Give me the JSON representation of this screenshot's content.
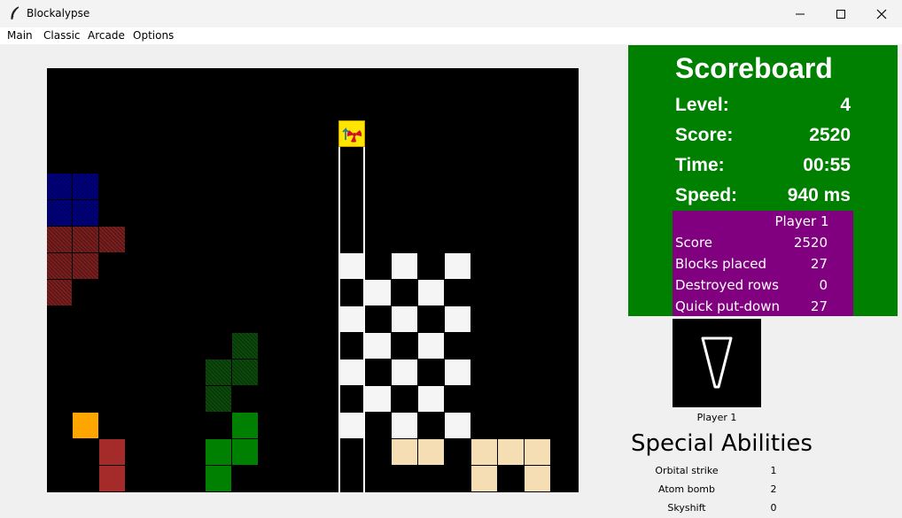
{
  "window": {
    "title": "Blockalypse",
    "controls": [
      "minimize-icon",
      "maximize-icon",
      "close-icon"
    ]
  },
  "menu": [
    "Main",
    "Classic",
    "Arcade",
    "Options"
  ],
  "board": {
    "columns": 20,
    "rows": 16,
    "background": "#000000",
    "falling_piece": {
      "type": "atom bomb",
      "icon": "radiation-icon",
      "column": 11,
      "row": 2
    },
    "blocks": [
      {
        "c": 0,
        "r": 4,
        "color": "#000080",
        "style": "hatch"
      },
      {
        "c": 1,
        "r": 4,
        "color": "#000080",
        "style": "hatch"
      },
      {
        "c": 0,
        "r": 5,
        "color": "#000080",
        "style": "hatch"
      },
      {
        "c": 1,
        "r": 5,
        "color": "#000080",
        "style": "hatch"
      },
      {
        "c": 0,
        "r": 6,
        "color": "#7a1e1e",
        "style": "hatch"
      },
      {
        "c": 1,
        "r": 6,
        "color": "#7a1e1e",
        "style": "hatch"
      },
      {
        "c": 2,
        "r": 6,
        "color": "#7a1e1e",
        "style": "hatch"
      },
      {
        "c": 0,
        "r": 7,
        "color": "#7a1e1e",
        "style": "hatch"
      },
      {
        "c": 1,
        "r": 7,
        "color": "#7a1e1e",
        "style": "hatch"
      },
      {
        "c": 0,
        "r": 8,
        "color": "#7a1e1e",
        "style": "hatch"
      },
      {
        "c": 7,
        "r": 10,
        "color": "#0b4a0b",
        "style": "hatch"
      },
      {
        "c": 6,
        "r": 11,
        "color": "#0b4a0b",
        "style": "hatch"
      },
      {
        "c": 7,
        "r": 11,
        "color": "#0b4a0b",
        "style": "hatch"
      },
      {
        "c": 6,
        "r": 12,
        "color": "#0b4a0b",
        "style": "hatch"
      },
      {
        "c": 1,
        "r": 13,
        "color": "#ffa500",
        "style": "solid"
      },
      {
        "c": 2,
        "r": 14,
        "color": "#a52a2a",
        "style": "solid"
      },
      {
        "c": 2,
        "r": 15,
        "color": "#a52a2a",
        "style": "solid"
      },
      {
        "c": 7,
        "r": 13,
        "color": "#008000",
        "style": "solid"
      },
      {
        "c": 6,
        "r": 14,
        "color": "#008000",
        "style": "solid"
      },
      {
        "c": 7,
        "r": 14,
        "color": "#008000",
        "style": "solid"
      },
      {
        "c": 6,
        "r": 15,
        "color": "#008000",
        "style": "solid"
      },
      {
        "c": 11,
        "r": 7,
        "color": "#f5f5f5",
        "style": "solid"
      },
      {
        "c": 13,
        "r": 7,
        "color": "#f5f5f5",
        "style": "solid"
      },
      {
        "c": 15,
        "r": 7,
        "color": "#f5f5f5",
        "style": "solid"
      },
      {
        "c": 12,
        "r": 8,
        "color": "#f5f5f5",
        "style": "solid"
      },
      {
        "c": 14,
        "r": 8,
        "color": "#f5f5f5",
        "style": "solid"
      },
      {
        "c": 11,
        "r": 9,
        "color": "#f5f5f5",
        "style": "solid"
      },
      {
        "c": 13,
        "r": 9,
        "color": "#f5f5f5",
        "style": "solid"
      },
      {
        "c": 15,
        "r": 9,
        "color": "#f5f5f5",
        "style": "solid"
      },
      {
        "c": 12,
        "r": 10,
        "color": "#f5f5f5",
        "style": "solid"
      },
      {
        "c": 14,
        "r": 10,
        "color": "#f5f5f5",
        "style": "solid"
      },
      {
        "c": 11,
        "r": 11,
        "color": "#f5f5f5",
        "style": "solid"
      },
      {
        "c": 13,
        "r": 11,
        "color": "#f5f5f5",
        "style": "solid"
      },
      {
        "c": 15,
        "r": 11,
        "color": "#f5f5f5",
        "style": "solid"
      },
      {
        "c": 12,
        "r": 12,
        "color": "#f5f5f5",
        "style": "solid"
      },
      {
        "c": 14,
        "r": 12,
        "color": "#f5f5f5",
        "style": "solid"
      },
      {
        "c": 11,
        "r": 13,
        "color": "#f5f5f5",
        "style": "solid"
      },
      {
        "c": 13,
        "r": 13,
        "color": "#f5f5f5",
        "style": "solid"
      },
      {
        "c": 15,
        "r": 13,
        "color": "#f5f5f5",
        "style": "solid"
      },
      {
        "c": 13,
        "r": 14,
        "color": "#f5deb3",
        "style": "solid"
      },
      {
        "c": 14,
        "r": 14,
        "color": "#f5deb3",
        "style": "solid"
      },
      {
        "c": 16,
        "r": 14,
        "color": "#f5deb3",
        "style": "solid"
      },
      {
        "c": 17,
        "r": 14,
        "color": "#f5deb3",
        "style": "solid"
      },
      {
        "c": 18,
        "r": 14,
        "color": "#f5deb3",
        "style": "solid"
      },
      {
        "c": 16,
        "r": 15,
        "color": "#f5deb3",
        "style": "solid"
      },
      {
        "c": 18,
        "r": 15,
        "color": "#f5deb3",
        "style": "solid"
      }
    ]
  },
  "scoreboard": {
    "title": "Scoreboard",
    "background": "#008000",
    "rows": [
      {
        "label": "Level:",
        "value": "4"
      },
      {
        "label": "Score:",
        "value": "2520"
      },
      {
        "label": "Time:",
        "value": "00:55"
      },
      {
        "label": "Speed:",
        "value": "940 ms"
      }
    ],
    "player_stats": {
      "background": "#800080",
      "header": "Player 1",
      "rows": [
        {
          "label": "Score",
          "value": "2520"
        },
        {
          "label": "Blocks placed",
          "value": "27"
        },
        {
          "label": "Destroyed rows",
          "value": "0"
        },
        {
          "label": "Quick put-down",
          "value": "27"
        }
      ]
    }
  },
  "next_piece": {
    "label": "Player 1",
    "icon": "orbital-strike-icon"
  },
  "special_abilities": {
    "title": "Special Abilities",
    "items": [
      {
        "name": "Orbital strike",
        "count": "1"
      },
      {
        "name": "Atom bomb",
        "count": "2"
      },
      {
        "name": "Skyshift",
        "count": "0"
      }
    ]
  }
}
